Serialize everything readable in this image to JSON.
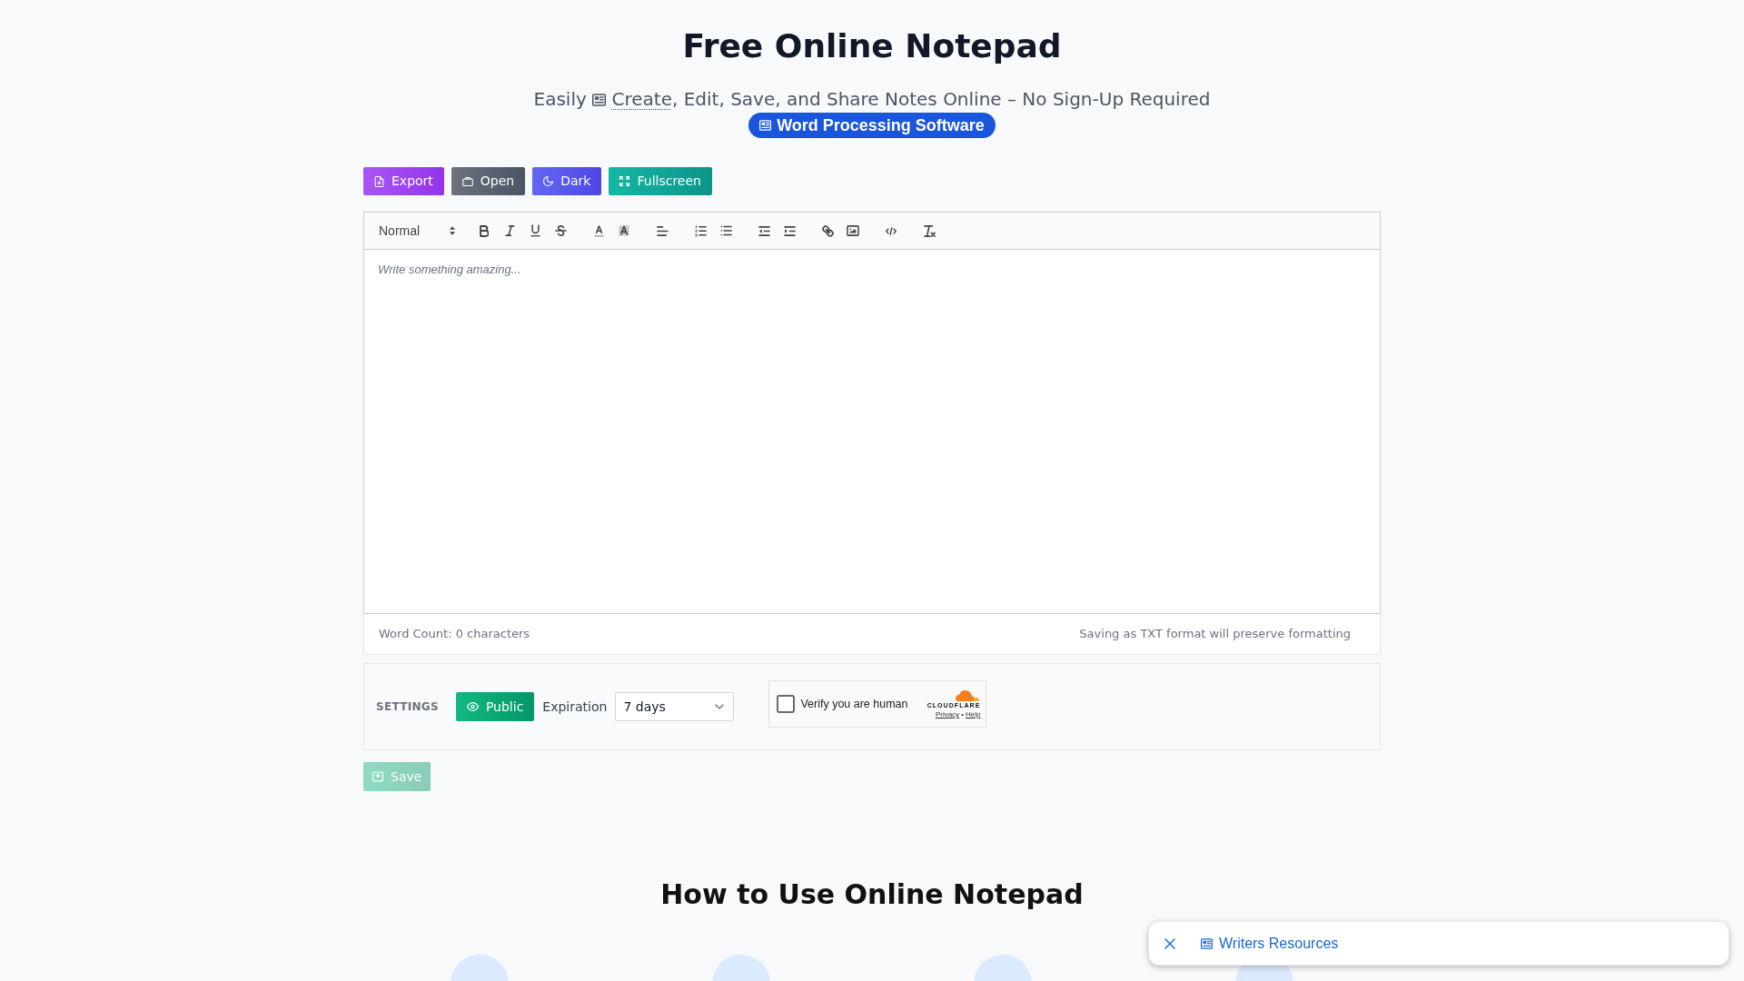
{
  "header": {
    "title": "Free Online Notepad",
    "subtitle": {
      "before": "Easily",
      "link": "Create",
      "after": ", Edit, Save, and Share Notes Online – No Sign-Up Required"
    },
    "badge": "Word Processing Software"
  },
  "actions": [
    {
      "kind": "export",
      "label": "Export"
    },
    {
      "kind": "open",
      "label": "Open"
    },
    {
      "kind": "dark",
      "label": "Dark"
    },
    {
      "kind": "fullscreen",
      "label": "Fullscreen"
    }
  ],
  "editor": {
    "format": "Normal",
    "placeholder": "Write something amazing...",
    "word_count": "Word Count: 0 characters",
    "format_note": "Saving as TXT format will preserve formatting"
  },
  "settings": {
    "heading": "SETTINGS",
    "visibility": {
      "label": "Public"
    },
    "expiration": {
      "label": "Expiration",
      "value": "7 days"
    },
    "captcha": {
      "label": "Verify you are human",
      "checked": false,
      "brand": "CLOUDFLARE",
      "links": [
        "Privacy",
        "Help"
      ],
      "separator": "•"
    }
  },
  "save_button": {
    "label": "Save",
    "disabled": true
  },
  "how_to": {
    "title": "How to Use Online Notepad"
  },
  "toast": {
    "label": "Writers Resources"
  }
}
